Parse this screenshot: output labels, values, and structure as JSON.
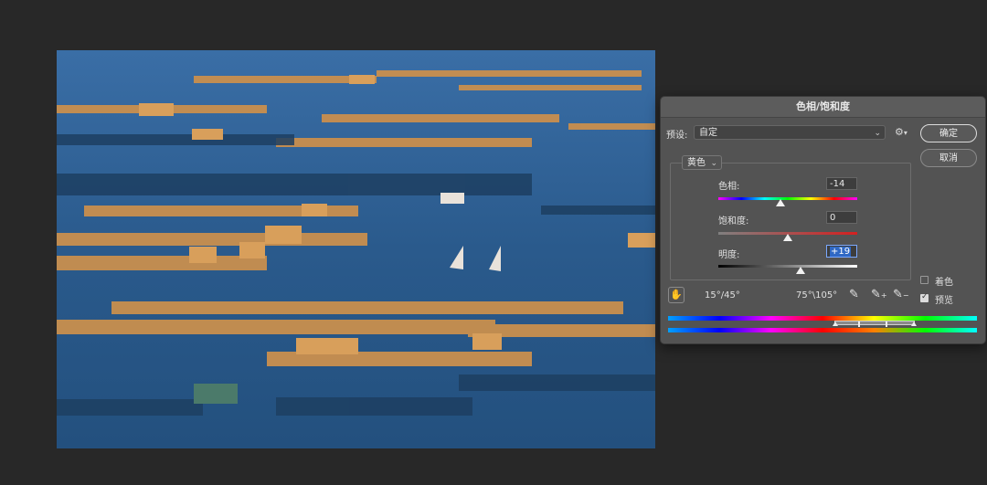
{
  "dialog": {
    "title": "色相/饱和度",
    "preset_label": "预设:",
    "preset_value": "自定",
    "ok_label": "确定",
    "cancel_label": "取消",
    "channel": "黄色",
    "hue_label": "色相:",
    "hue_value": "-14",
    "hue_level": 0.45,
    "saturation_label": "饱和度:",
    "saturation_value": "0",
    "saturation_level": 0.5,
    "lightness_label": "明度:",
    "lightness_value": "+19",
    "lightness_level": 0.595,
    "colorize_label": "着色",
    "colorize_checked": false,
    "preview_label": "预览",
    "preview_checked": true,
    "range_left": "15°/45°",
    "range_right": "75°\\105°"
  },
  "colors": {
    "dialog_bg": "#535353",
    "app_bg": "#282828",
    "water": "#2a5a8c",
    "highlight": "#2f68c4"
  },
  "icons": [
    "gear-icon",
    "hand-icon",
    "eyedropper-icon",
    "eyedropper-plus-icon",
    "eyedropper-minus-icon",
    "chevron-down-icon"
  ]
}
